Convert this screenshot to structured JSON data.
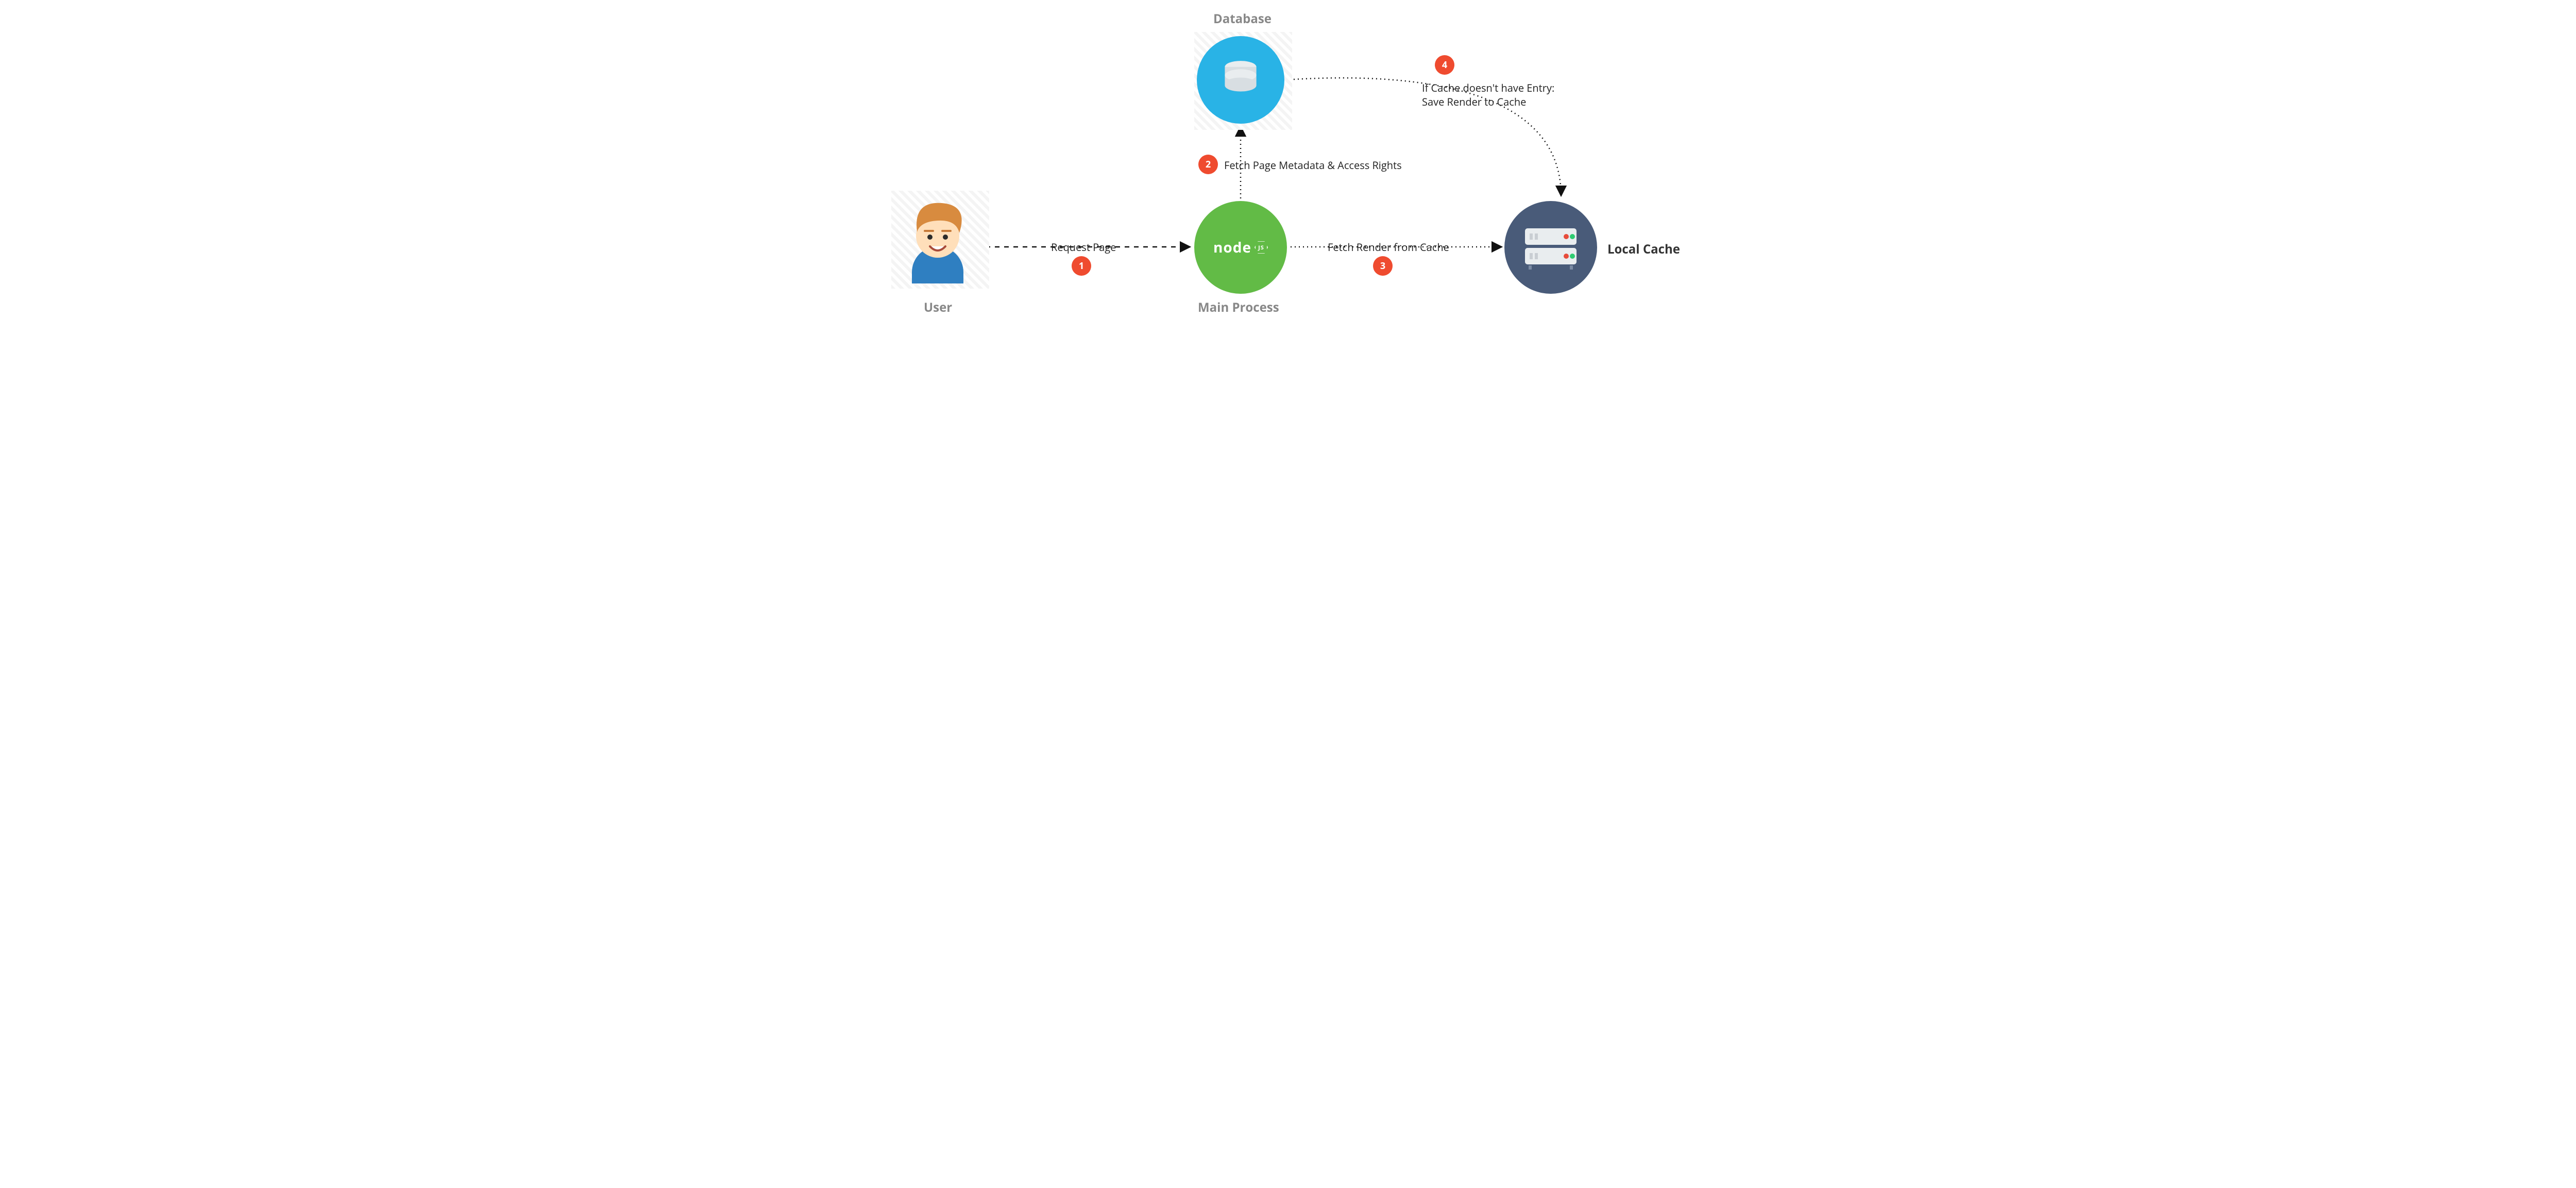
{
  "nodes": {
    "user": {
      "label": "User"
    },
    "main_process": {
      "label": "Main Process",
      "badge_text": "node",
      "badge_suffix": "JS"
    },
    "database": {
      "label": "Database"
    },
    "local_cache": {
      "label": "Local Cache"
    }
  },
  "steps": {
    "s1": {
      "num": "1",
      "label": "Request Page"
    },
    "s2": {
      "num": "2",
      "label": "Fetch Page Metadata & Access Rights"
    },
    "s3": {
      "num": "3",
      "label": "Fetch Render from Cache"
    },
    "s4": {
      "num": "4",
      "label_line1": "If Cache doesn't have Entry:",
      "label_line2": "Save Render to Cache"
    }
  },
  "colors": {
    "accent": "#ef4b2f",
    "database": "#29b3e6",
    "main": "#62bb46",
    "cache": "#495b79",
    "muted": "#888888"
  }
}
